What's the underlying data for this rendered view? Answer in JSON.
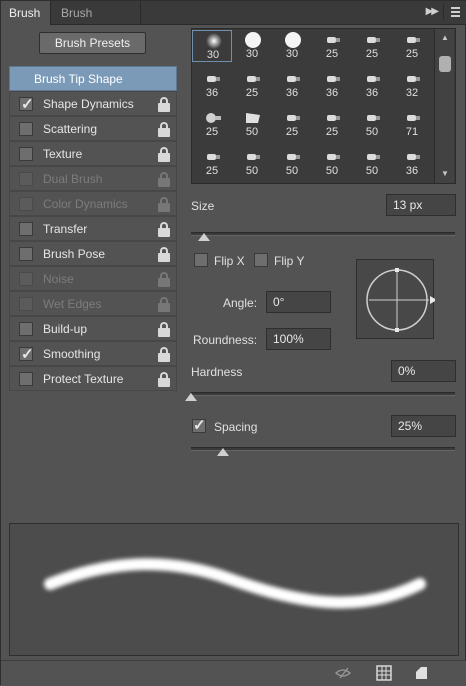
{
  "tabs": {
    "brush": "Brush",
    "presets": "Brush Presets"
  },
  "brush_presets_button": "Brush Presets",
  "options": [
    {
      "label": "Brush Tip Shape",
      "state": "selected",
      "checked": false,
      "lock": false
    },
    {
      "label": "Shape Dynamics",
      "state": "enabled",
      "checked": true,
      "lock": true
    },
    {
      "label": "Scattering",
      "state": "enabled",
      "checked": false,
      "lock": true
    },
    {
      "label": "Texture",
      "state": "enabled",
      "checked": false,
      "lock": true
    },
    {
      "label": "Dual Brush",
      "state": "disabled",
      "checked": false,
      "lock": true
    },
    {
      "label": "Color Dynamics",
      "state": "disabled",
      "checked": false,
      "lock": true
    },
    {
      "label": "Transfer",
      "state": "enabled",
      "checked": false,
      "lock": true
    },
    {
      "label": "Brush Pose",
      "state": "enabled",
      "checked": false,
      "lock": true
    },
    {
      "label": "Noise",
      "state": "disabled",
      "checked": false,
      "lock": true
    },
    {
      "label": "Wet Edges",
      "state": "disabled",
      "checked": false,
      "lock": true
    },
    {
      "label": "Build-up",
      "state": "enabled",
      "checked": false,
      "lock": true
    },
    {
      "label": "Smoothing",
      "state": "enabled",
      "checked": true,
      "lock": true
    },
    {
      "label": "Protect Texture",
      "state": "enabled",
      "checked": false,
      "lock": true
    }
  ],
  "tip_sizes": [
    [
      "30",
      "30",
      "30",
      "25",
      "25",
      "25"
    ],
    [
      "36",
      "25",
      "36",
      "36",
      "36",
      "32"
    ],
    [
      "25",
      "50",
      "25",
      "25",
      "50",
      "71"
    ],
    [
      "25",
      "50",
      "50",
      "50",
      "50",
      "36"
    ]
  ],
  "tip_shapes": [
    [
      "soft-round",
      "hard-round",
      "hard-round",
      "bristle",
      "bristle",
      "bristle"
    ],
    [
      "bristle",
      "bristle",
      "bristle",
      "bristle",
      "bristle",
      "bristle"
    ],
    [
      "airbrush",
      "chisel",
      "bristle",
      "bristle",
      "bristle",
      "bristle"
    ],
    [
      "bristle",
      "bristle",
      "bristle",
      "bristle",
      "bristle",
      "bristle"
    ]
  ],
  "size": {
    "label": "Size",
    "value": "13 px",
    "fraction": 0.05
  },
  "flip_x": {
    "label": "Flip X",
    "checked": false
  },
  "flip_y": {
    "label": "Flip Y",
    "checked": false
  },
  "angle": {
    "label": "Angle:",
    "value": "0°"
  },
  "roundness": {
    "label": "Roundness:",
    "value": "100%"
  },
  "hardness": {
    "label": "Hardness",
    "value": "0%",
    "fraction": 0.0
  },
  "spacing": {
    "label": "Spacing",
    "value": "25%",
    "checked": true,
    "fraction": 0.12
  },
  "icons": {
    "tab_collapse": "collapse-arrows-icon",
    "tab_menu": "panel-menu-icon",
    "bottom": [
      "toggle-visibility-icon",
      "grid-icon",
      "new-preset-icon"
    ]
  }
}
